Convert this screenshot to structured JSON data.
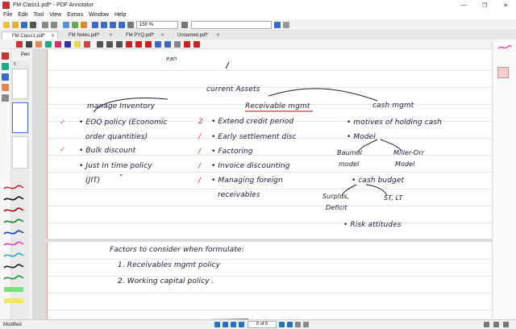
{
  "window": {
    "title": "FM Class1.pdf* - PDF Annotator",
    "minimize": "—",
    "maximize": "❐",
    "close": "✕"
  },
  "menu": [
    "File",
    "Edit",
    "Tool",
    "View",
    "Extras",
    "Window",
    "Help"
  ],
  "toolbar": {
    "zoom": "150 %"
  },
  "tabs": [
    {
      "label": "FM Class1.pdf*",
      "active": true
    },
    {
      "label": "FM Notes.pdf*",
      "active": false
    },
    {
      "label": "FM PYQ.pdf*",
      "active": false
    },
    {
      "label": "Unnamed.pdf*",
      "active": false
    }
  ],
  "toolbar3": {
    "label": "Pen"
  },
  "thumbnails": {
    "page_number": "5"
  },
  "note": {
    "top_scribble": "ean",
    "current_assets": "current Assets",
    "col1": {
      "heading": "manage Inventory",
      "items": [
        "EOQ policy (Economic",
        "order quantities)",
        "Bulk discount",
        "Just In time policy",
        "(JIT)"
      ]
    },
    "col2": {
      "heading": "Receivable mgmt",
      "items": [
        "Extend credit period",
        "Early settlement disc",
        "Factoring",
        "Invoice discounting",
        "Managing foreign",
        "receivables"
      ]
    },
    "col3": {
      "heading": "cash mgmt",
      "items": [
        "motives of holding cash",
        "Model",
        "Baumol",
        "model",
        "Miller-Orr",
        "Model",
        "cash budget",
        "Surplus,",
        "Deficit",
        "ST, LT",
        "Risk attitudes"
      ]
    },
    "marks": {
      "check": "✓",
      "cross": "/",
      "two": "2"
    },
    "page2": {
      "heading": "Factors to consider when formulate:",
      "items": [
        "1. Receivables mgmt policy",
        "2. Working capital policy ."
      ]
    }
  },
  "status": {
    "left": "Modified",
    "page": "6 of 9"
  },
  "colors": {
    "accent_red": "#d12b2b",
    "ink": "#1a1a3a",
    "pink": "#e040c0"
  }
}
